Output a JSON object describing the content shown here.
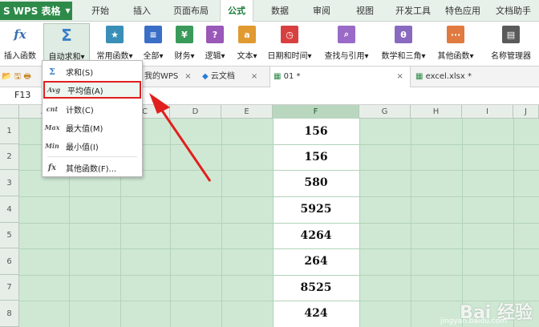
{
  "app": {
    "title": "WPS 表格",
    "logo": "S"
  },
  "menu_tabs": [
    "开始",
    "插入",
    "页面布局",
    "公式",
    "数据",
    "审阅",
    "视图",
    "开发工具",
    "特色应用",
    "文档助手"
  ],
  "active_tab": "公式",
  "ribbon": {
    "insert_fn": "插入函数",
    "autosum": "自动求和",
    "common_fn": "常用函数",
    "all": "全部",
    "finance": "财务",
    "logic": "逻辑",
    "text": "文本",
    "datetime": "日期和时间",
    "lookup": "查找与引用",
    "math": "数学和三角",
    "other": "其他函数",
    "name_mgr": "名称管理器"
  },
  "doc_tabs": [
    "我的WPS",
    "云文档",
    "01 *",
    "excel.xlsx *"
  ],
  "name_box": "F13",
  "columns": [
    "A",
    "B",
    "C",
    "D",
    "E",
    "F",
    "G",
    "H",
    "I",
    "J"
  ],
  "rows": [
    "1",
    "2",
    "3",
    "4",
    "5",
    "6",
    "7",
    "8"
  ],
  "column_f_values": [
    "156",
    "156",
    "580",
    "5925",
    "4264",
    "264",
    "8525",
    "424"
  ],
  "dropdown": {
    "items": [
      {
        "icon": "Σ",
        "label": "求和(S)"
      },
      {
        "icon": "Avg",
        "label": "平均值(A)"
      },
      {
        "icon": "cnt",
        "label": "计数(C)"
      },
      {
        "icon": "Max",
        "label": "最大值(M)"
      },
      {
        "icon": "Min",
        "label": "最小值(I)"
      },
      {
        "icon": "fx",
        "label": "其他函数(F)..."
      }
    ]
  },
  "watermark": {
    "brand": "Bai 经验",
    "url": "jingyan.baidu.com"
  },
  "colors": {
    "accent": "#2d8a49",
    "highlight": "#e0201e",
    "grid": "#cfe8d4"
  }
}
